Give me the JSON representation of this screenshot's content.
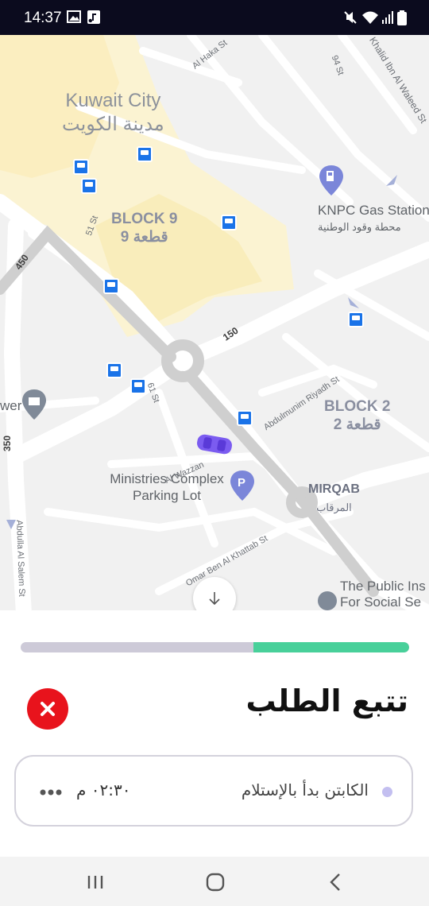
{
  "status_bar": {
    "time": "14:37",
    "left_icons": [
      "image-icon",
      "music-note-icon"
    ],
    "right_icons": [
      "mute-icon",
      "wifi-icon",
      "signal-icon",
      "battery-icon"
    ]
  },
  "map": {
    "city_label_en": "Kuwait City",
    "city_label_ar": "مدينة الكويت",
    "districts": [
      {
        "en": "BLOCK 9",
        "ar": "قطعة 9"
      },
      {
        "en": "BLOCK 2",
        "ar": "قطعة 2"
      },
      {
        "en": "MIRQAB",
        "ar": "المرقاب"
      }
    ],
    "pois": {
      "gas_station_en": "KNPC Gas Station",
      "gas_station_ar": "محطة وقود الوطنية",
      "parking": "Ministries Complex Parking Lot",
      "public_institution": "The Public Ins For Social Se",
      "tower": "wer"
    },
    "streets": {
      "al_haka": "Al Haka St",
      "st_94": "94 St",
      "khalid": "Khalid Ibn Al Waleed St",
      "st_51": "51 St",
      "st_61": "61 St",
      "abdulmunim": "Abdulmunim Riyadh St",
      "al_wazzan": "Al Wazzan",
      "omar": "Omar Ben Al Khattab St",
      "abdulla": "Abdulla Al Salem St"
    },
    "routes": {
      "r450": "450",
      "r150": "150",
      "r350": "350"
    },
    "vehicle_color": "#7b5cf0"
  },
  "tracking": {
    "title": "تتبع الطلب",
    "progress_fraction": 0.4,
    "progress_fill_color": "#48d09a",
    "progress_track_color": "#cdcad8",
    "close_color": "#e8131c",
    "status_text": "الكابتن بدأ بالإستلام",
    "status_time": "٠٢:٣٠ م"
  },
  "nav": {
    "recent_label": "recent-apps",
    "home_label": "home",
    "back_label": "back"
  }
}
